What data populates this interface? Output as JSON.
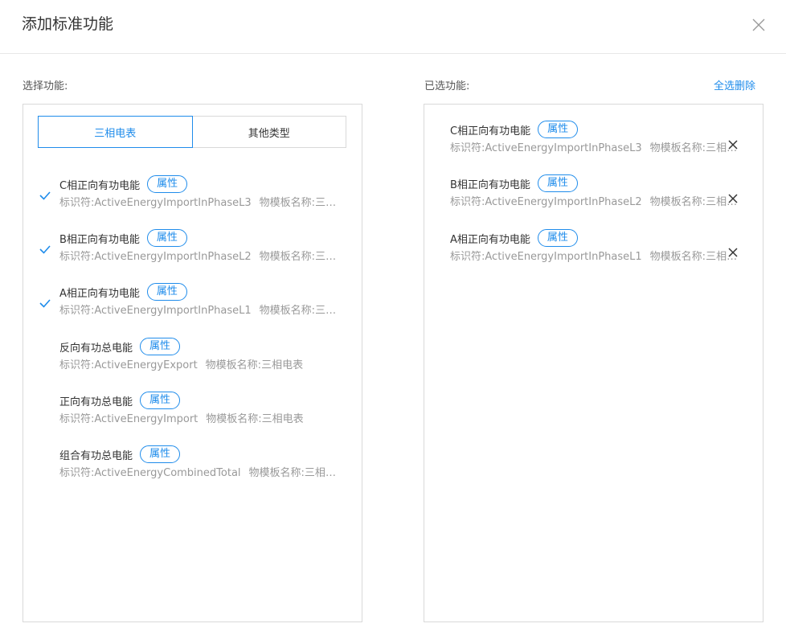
{
  "dialog": {
    "title": "添加标准功能",
    "close_icon": "close-icon"
  },
  "left": {
    "label": "选择功能:",
    "tabs": [
      {
        "label": "三相电表",
        "active": true
      },
      {
        "label": "其他类型",
        "active": false
      }
    ],
    "items": [
      {
        "name": "C相正向有功电能",
        "badge": "属性",
        "id_label": "标识符:",
        "id": "ActiveEnergyImportInPhaseL3",
        "tpl_label": "物模板名称:",
        "tpl": "三相电表",
        "checked": true
      },
      {
        "name": "B相正向有功电能",
        "badge": "属性",
        "id_label": "标识符:",
        "id": "ActiveEnergyImportInPhaseL2",
        "tpl_label": "物模板名称:",
        "tpl": "三相电表",
        "checked": true
      },
      {
        "name": "A相正向有功电能",
        "badge": "属性",
        "id_label": "标识符:",
        "id": "ActiveEnergyImportInPhaseL1",
        "tpl_label": "物模板名称:",
        "tpl": "三相电表",
        "checked": true
      },
      {
        "name": "反向有功总电能",
        "badge": "属性",
        "id_label": "标识符:",
        "id": "ActiveEnergyExport",
        "tpl_label": "物模板名称:",
        "tpl": "三相电表",
        "checked": false
      },
      {
        "name": "正向有功总电能",
        "badge": "属性",
        "id_label": "标识符:",
        "id": "ActiveEnergyImport",
        "tpl_label": "物模板名称:",
        "tpl": "三相电表",
        "checked": false
      },
      {
        "name": "组合有功总电能",
        "badge": "属性",
        "id_label": "标识符:",
        "id": "ActiveEnergyCombinedTotal",
        "tpl_label": "物模板名称:",
        "tpl": "三相电表",
        "checked": false
      }
    ]
  },
  "right": {
    "label": "已选功能:",
    "clear_all": "全选删除",
    "items": [
      {
        "name": "C相正向有功电能",
        "badge": "属性",
        "id_label": "标识符:",
        "id": "ActiveEnergyImportInPhaseL3",
        "tpl_label": "物模板名称:",
        "tpl": "三相电表"
      },
      {
        "name": "B相正向有功电能",
        "badge": "属性",
        "id_label": "标识符:",
        "id": "ActiveEnergyImportInPhaseL2",
        "tpl_label": "物模板名称:",
        "tpl": "三相电表"
      },
      {
        "name": "A相正向有功电能",
        "badge": "属性",
        "id_label": "标识符:",
        "id": "ActiveEnergyImportInPhaseL1",
        "tpl_label": "物模板名称:",
        "tpl": "三相电表"
      }
    ]
  },
  "colors": {
    "accent": "#1f8ceb",
    "muted_text": "#999999",
    "border": "#d9d9d9"
  }
}
